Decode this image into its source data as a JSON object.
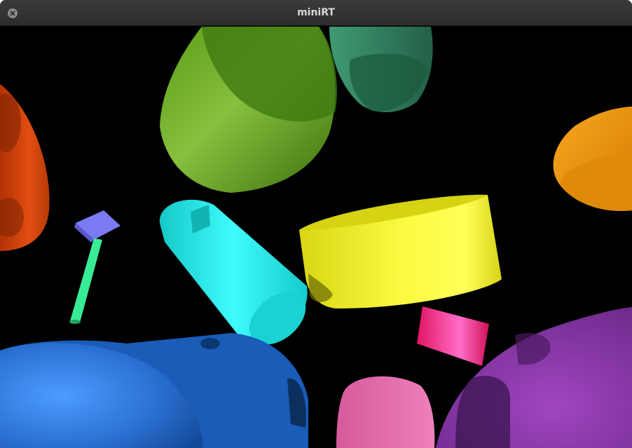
{
  "window": {
    "title": "miniRT",
    "close_icon": "close-icon"
  },
  "scene": {
    "background": "#000000",
    "objects": [
      {
        "name": "orange-cylinder",
        "color": "#e04a10"
      },
      {
        "name": "green-cylinder",
        "color": "#5e9a1c"
      },
      {
        "name": "teal-cylinder",
        "color": "#2f7a55"
      },
      {
        "name": "amber-cylinder",
        "color": "#f39a0a"
      },
      {
        "name": "cyan-cylinder",
        "color": "#22f0f0"
      },
      {
        "name": "yellow-cylinder",
        "color": "#f4f22a"
      },
      {
        "name": "purple-blue-disc",
        "color": "#7a7aee"
      },
      {
        "name": "mint-green-rod",
        "color": "#33e890"
      },
      {
        "name": "magenta-cylinder",
        "color": "#f21e74"
      },
      {
        "name": "blue-cylinder",
        "color": "#1f66c8"
      },
      {
        "name": "pink-cylinder",
        "color": "#e26aa8"
      },
      {
        "name": "purple-cylinder",
        "color": "#8a3aa8"
      }
    ]
  }
}
